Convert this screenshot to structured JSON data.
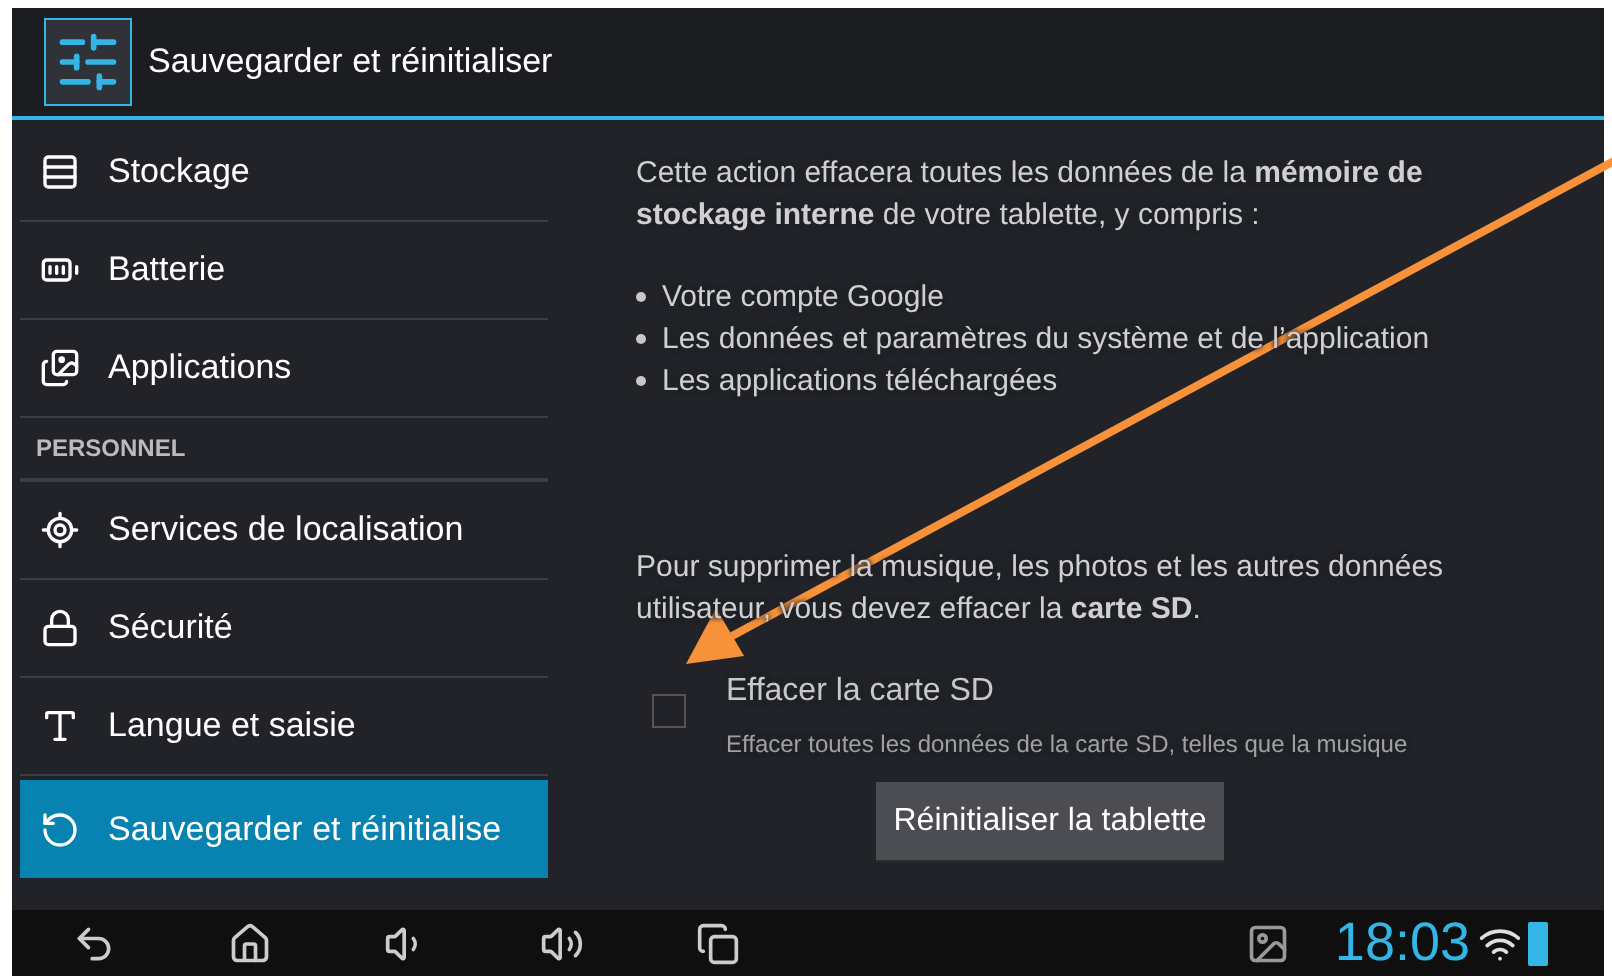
{
  "title_bar": {
    "title": "Sauvegarder et réinitialiser"
  },
  "sidebar": {
    "items": [
      {
        "kind": "item",
        "label": "Stockage",
        "selected": false
      },
      {
        "kind": "item",
        "label": "Batterie",
        "selected": false
      },
      {
        "kind": "item",
        "label": "Applications",
        "selected": false
      },
      {
        "kind": "header",
        "label": "PERSONNEL"
      },
      {
        "kind": "item",
        "label": "Services de localisation",
        "selected": false
      },
      {
        "kind": "item",
        "label": "Sécurité",
        "selected": false
      },
      {
        "kind": "item",
        "label": "Langue et saisie",
        "selected": false
      },
      {
        "kind": "item",
        "label": "Sauvegarder et réinitialise",
        "selected": true
      }
    ]
  },
  "content": {
    "description": "Cette action effacera toutes les données de la **mémoire de stockage interne** de votre tablette, y compris :",
    "bullets": [
      "Votre compte Google",
      "Les données et paramètres du système et de l’application",
      "Les applications téléchargées"
    ],
    "sd_note": "Pour supprimer la musique, les photos et les autres données utilisateur, vous devez effacer la **carte SD**.",
    "option": {
      "title": "Effacer la carte SD",
      "summary": "Effacer toutes les données de la carte SD, telles que la musique",
      "checked": false
    },
    "button": "Réinitialiser la tablette"
  },
  "status_bar": {
    "time": "18:03"
  }
}
